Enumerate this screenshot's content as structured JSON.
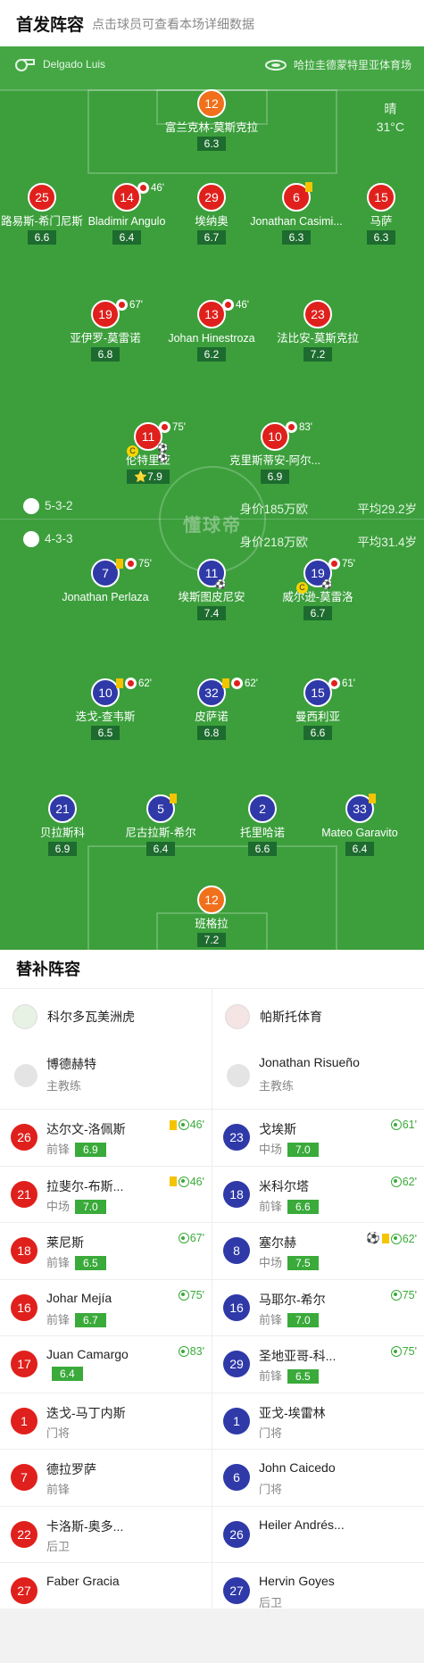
{
  "header": {
    "title": "首发阵容",
    "subtitle": "点击球员可查看本场详细数据"
  },
  "venue": {
    "referee": "Delgado Luis",
    "stadium": "哈拉圭德蒙特里亚体育场"
  },
  "weather": {
    "condition": "晴",
    "temp": "31°C"
  },
  "home_lineup": {
    "gk": {
      "num": "12",
      "name": "富兰克林-莫斯克拉",
      "rating": "6.3"
    },
    "def": [
      {
        "num": "25",
        "name": "路易斯-希门尼斯",
        "rating": "6.6"
      },
      {
        "num": "14",
        "name": "Bladimir Angulo",
        "rating": "6.4",
        "sub": "46'"
      },
      {
        "num": "29",
        "name": "埃纳奥",
        "rating": "6.7"
      },
      {
        "num": "6",
        "name": "Jonathan Casimi...",
        "rating": "6.3",
        "card": "yellow"
      },
      {
        "num": "15",
        "name": "马萨",
        "rating": "6.3"
      }
    ],
    "mid": [
      {
        "num": "19",
        "name": "亚伊罗-莫雷诺",
        "rating": "6.8",
        "sub": "67'"
      },
      {
        "num": "13",
        "name": "Johan Hinestroza",
        "rating": "6.2",
        "sub": "46'"
      },
      {
        "num": "23",
        "name": "法比安-莫斯克拉",
        "rating": "7.2"
      }
    ],
    "fwd": [
      {
        "num": "11",
        "name": "伦特里亚",
        "rating": "7.9",
        "sub": "75'",
        "captain": "C",
        "star": "⭐"
      },
      {
        "num": "10",
        "name": "克里斯蒂安-阿尔...",
        "rating": "6.9",
        "sub": "83'"
      }
    ]
  },
  "home_info": {
    "formation": "5-3-2",
    "value": "身价185万欧",
    "age": "平均29.2岁"
  },
  "away_info": {
    "formation": "4-3-3",
    "value": "身价218万欧",
    "age": "平均31.4岁"
  },
  "watermark": "懂球帝",
  "away_lineup": {
    "fwd": [
      {
        "num": "7",
        "name": "Jonathan Perlaza",
        "sub": "75'",
        "card": "yellow"
      },
      {
        "num": "11",
        "name": "埃斯图皮尼安",
        "rating": "7.4",
        "goal": "⚽"
      },
      {
        "num": "19",
        "name": "威尔逊-莫雷洛",
        "rating": "6.7",
        "sub": "75'",
        "captain": "C",
        "goal": "⚽"
      }
    ],
    "mid": [
      {
        "num": "10",
        "name": "迭戈-查韦斯",
        "rating": "6.5",
        "sub": "62'",
        "card": "yellow"
      },
      {
        "num": "32",
        "name": "皮萨诺",
        "rating": "6.8",
        "sub": "62'",
        "card": "yellow"
      },
      {
        "num": "15",
        "name": "曼西利亚",
        "rating": "6.6",
        "sub": "61'"
      }
    ],
    "def": [
      {
        "num": "21",
        "name": "贝拉斯科",
        "rating": "6.9"
      },
      {
        "num": "5",
        "name": "尼古拉斯-希尔",
        "rating": "6.4",
        "card": "yellow"
      },
      {
        "num": "2",
        "name": "托里哈诺",
        "rating": "6.6"
      },
      {
        "num": "33",
        "name": "Mateo Garavito",
        "rating": "6.4",
        "card": "yellow"
      }
    ],
    "gk": {
      "num": "12",
      "name": "班格拉",
      "rating": "7.2"
    }
  },
  "subs": {
    "title": "替补阵容",
    "home": {
      "team": "科尔多瓦美洲虎",
      "coach": {
        "name": "博德赫特",
        "role": "主教练"
      },
      "players": [
        {
          "num": "26",
          "name": "达尔文-洛佩斯",
          "pos": "前锋",
          "rating": "6.9",
          "ev": "46'",
          "card": "yellow"
        },
        {
          "num": "21",
          "name": "拉斐尔-布斯...",
          "pos": "中场",
          "rating": "7.0",
          "ev": "46'",
          "card": "yellow"
        },
        {
          "num": "18",
          "name": "莱尼斯",
          "pos": "前锋",
          "rating": "6.5",
          "ev": "67'"
        },
        {
          "num": "16",
          "name": "Johar Mejía",
          "pos": "前锋",
          "rating": "6.7",
          "ev": "75'"
        },
        {
          "num": "17",
          "name": "Juan Camargo",
          "pos": "",
          "rating": "6.4",
          "ev": "83'"
        },
        {
          "num": "1",
          "name": "迭戈-马丁内斯",
          "pos": "门将"
        },
        {
          "num": "7",
          "name": "德拉罗萨",
          "pos": "前锋"
        },
        {
          "num": "22",
          "name": "卡洛斯-奥多...",
          "pos": "后卫"
        },
        {
          "num": "27",
          "name": "Faber Gracia",
          "pos": ""
        }
      ]
    },
    "away": {
      "team": "帕斯托体育",
      "coach": {
        "name": "Jonathan Risueño",
        "role": "主教练"
      },
      "players": [
        {
          "num": "23",
          "name": "戈埃斯",
          "pos": "中场",
          "rating": "7.0",
          "ev": "61'"
        },
        {
          "num": "18",
          "name": "米科尔塔",
          "pos": "前锋",
          "rating": "6.6",
          "ev": "62'"
        },
        {
          "num": "8",
          "name": "塞尔赫",
          "pos": "中场",
          "rating": "7.5",
          "ev": "62'",
          "card": "yellow",
          "goal": "⚽"
        },
        {
          "num": "16",
          "name": "马耶尔-希尔",
          "pos": "前锋",
          "rating": "7.0",
          "ev": "75'"
        },
        {
          "num": "29",
          "name": "圣地亚哥-科...",
          "pos": "前锋",
          "rating": "6.5",
          "ev": "75'"
        },
        {
          "num": "1",
          "name": "亚戈-埃雷林",
          "pos": "门将"
        },
        {
          "num": "6",
          "name": "John Caicedo",
          "pos": "门将"
        },
        {
          "num": "26",
          "name": "Heiler Andrés...",
          "pos": ""
        },
        {
          "num": "27",
          "name": "Hervin Goyes",
          "pos": "后卫"
        }
      ]
    }
  },
  "colors": {
    "home": "#e0201c",
    "away": "#2f39a8",
    "gk": "#f0701c",
    "pitch": "#3c9f3c",
    "rating_bg": "#3aaa3a"
  }
}
